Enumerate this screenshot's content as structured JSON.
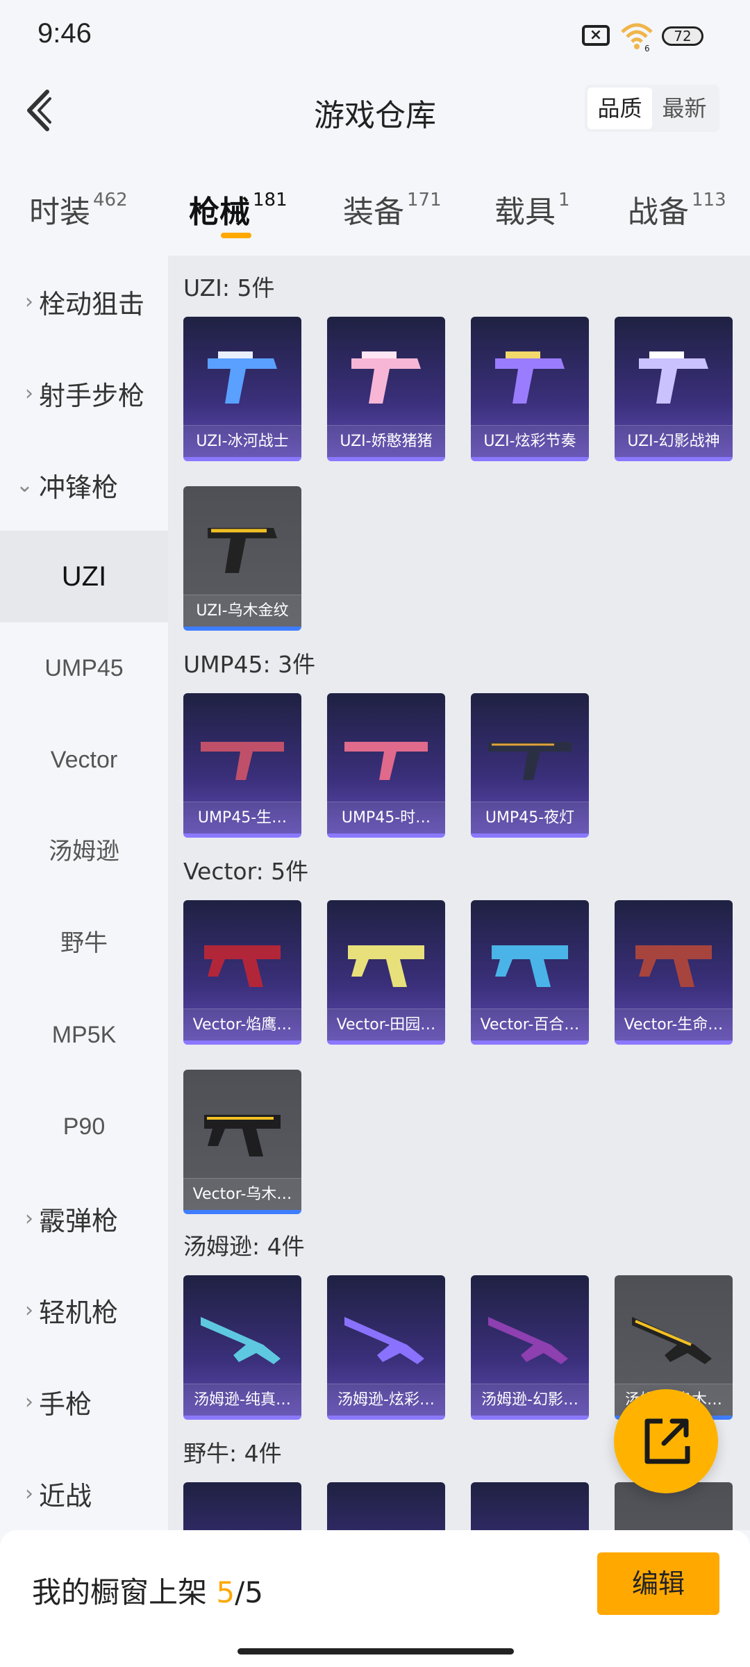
{
  "status_bar": {
    "time": "9:46",
    "battery": "72",
    "network": "6"
  },
  "header": {
    "title": "游戏仓库",
    "sort_options": [
      "品质",
      "最新"
    ],
    "sort_active": "品质"
  },
  "tabs": [
    {
      "label": "时装",
      "count": "462"
    },
    {
      "label": "枪械",
      "count": "181"
    },
    {
      "label": "装备",
      "count": "171"
    },
    {
      "label": "载具",
      "count": "1"
    },
    {
      "label": "战备",
      "count": "113"
    }
  ],
  "sidebar": {
    "categories": [
      "栓动狙击",
      "射手步枪",
      "冲锋枪",
      "霰弹枪",
      "轻机枪",
      "手枪",
      "近战"
    ],
    "subitems": [
      "UZI",
      "UMP45",
      "Vector",
      "汤姆逊",
      "野牛",
      "MP5K",
      "P90"
    ],
    "active_subitem": "UZI"
  },
  "sections": [
    {
      "title": "UZI: 5件",
      "items": [
        "UZI-冰河战士",
        "UZI-娇憨猪猪",
        "UZI-炫彩节奏",
        "UZI-幻影战神",
        "UZI-乌木金纹"
      ]
    },
    {
      "title": "UMP45: 3件",
      "items": [
        "UMP45-生…",
        "UMP45-时…",
        "UMP45-夜灯"
      ]
    },
    {
      "title": "Vector: 5件",
      "items": [
        "Vector-焰鹰…",
        "Vector-田园…",
        "Vector-百合…",
        "Vector-生命…",
        "Vector-乌木…"
      ]
    },
    {
      "title": "汤姆逊: 4件",
      "items": [
        "汤姆逊-纯真…",
        "汤姆逊-炫彩…",
        "汤姆逊-幻影…",
        "汤姆逊-乌木…"
      ]
    },
    {
      "title": "野牛: 4件",
      "items": []
    }
  ],
  "bottom": {
    "showcase_label": "我的橱窗上架",
    "showcase_used": "5",
    "showcase_total": "/5",
    "edit_label": "编辑"
  },
  "colors": {
    "accent": "#ffa800",
    "card_purple": "#3a2f7a",
    "card_grey": "#55575d"
  }
}
